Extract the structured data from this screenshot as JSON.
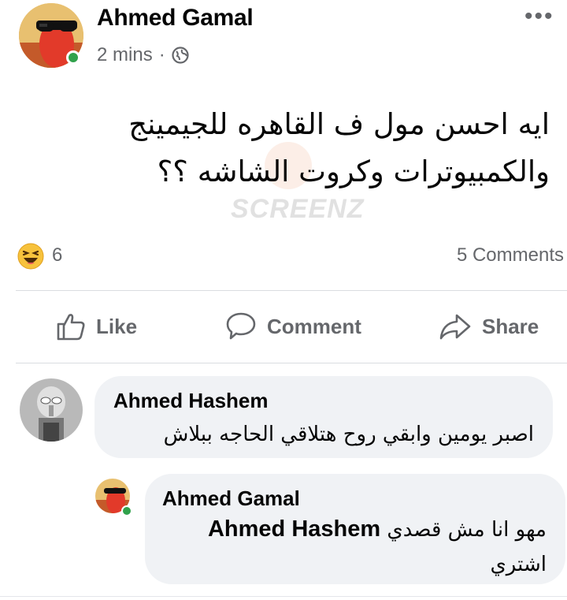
{
  "post": {
    "author": "Ahmed Gamal",
    "time": "2 mins",
    "separator": "·",
    "text_line1": "ايه احسن مول ف القاهره للجيمينج",
    "text_line2": "والكمبيوترات وكروت الشاشه ؟؟",
    "watermark": "SCREENZ",
    "reaction_count": "6",
    "comments_count": "5 Comments"
  },
  "actions": {
    "like": "Like",
    "comment": "Comment",
    "share": "Share"
  },
  "comments": [
    {
      "author": "Ahmed Hashem",
      "text": "اصبر يومين وابقي روح هتلاقي الحاجه ببلاش"
    },
    {
      "author": "Ahmed Gamal",
      "mention": "Ahmed Hashem",
      "text_part1": "مهو انا مش قصدي",
      "text_part2": "اشتري"
    }
  ],
  "colors": {
    "text": "#050505",
    "secondary": "#65676b",
    "bubble": "#f0f2f5",
    "online": "#31a24c"
  }
}
